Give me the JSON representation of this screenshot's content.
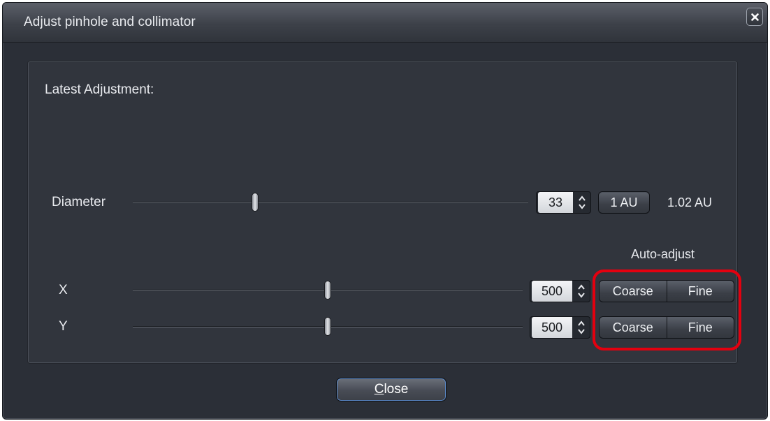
{
  "window": {
    "title": "Adjust pinhole and collimator"
  },
  "panel": {
    "heading": "Latest Adjustment:",
    "diameter": {
      "label": "Diameter",
      "value": "33",
      "slider_fraction": 0.31,
      "au_button_label": "1 AU",
      "au_readout": "1.02 AU"
    },
    "auto_adjust_label": "Auto-adjust",
    "x": {
      "label": "X",
      "value": "500",
      "slider_fraction": 0.5,
      "coarse_label": "Coarse",
      "fine_label": "Fine"
    },
    "y": {
      "label": "Y",
      "value": "500",
      "slider_fraction": 0.5,
      "coarse_label": "Coarse",
      "fine_label": "Fine"
    }
  },
  "footer": {
    "close_label_first": "C",
    "close_label_rest": "lose"
  },
  "colors": {
    "window_bg": "#2b2f37",
    "panel_bg": "#31353d",
    "highlight_ring": "#e3000f",
    "focus_ring": "#5b89c9"
  },
  "icons": {
    "window_close": "close-icon",
    "spinner": "spinner-arrows-icon"
  }
}
